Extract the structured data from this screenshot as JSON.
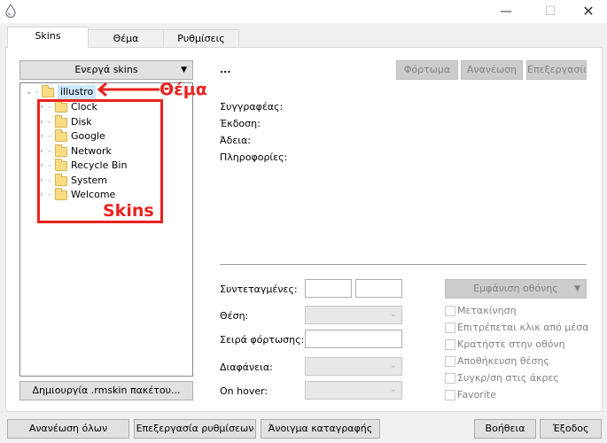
{
  "window": {
    "minimize_glyph": "—",
    "maximize_glyph": "☐",
    "close_glyph": "✕",
    "app_icon": "rainmeter-drop-icon"
  },
  "tabs": [
    {
      "label": "Skins",
      "active": true
    },
    {
      "label": "Θέμα",
      "active": false
    },
    {
      "label": "Ρυθμίσεις",
      "active": false
    }
  ],
  "skins_panel": {
    "active_skins_button": "Ενεργά skins",
    "tree": {
      "root": "illustro",
      "children": [
        "Clock",
        "Disk",
        "Google",
        "Network",
        "Recycle Bin",
        "System",
        "Welcome"
      ]
    },
    "create_package_button": "Δημιουργία .rmskin πακέτου..."
  },
  "details": {
    "skin_name": "...",
    "load_button": "Φόρτωμα",
    "refresh_button": "Ανανέωση",
    "edit_button": "Επεξεργασία",
    "author_label": "Συγγραφέας:",
    "version_label": "Έκδοση:",
    "license_label": "Άδεια:",
    "info_label": "Πληροφορίες:"
  },
  "settings": {
    "coordinates_label": "Συντεταγμένες:",
    "position_label": "Θέση:",
    "load_order_label": "Σειρά φόρτωσης:",
    "transparency_label": "Διαφάνεια:",
    "on_hover_label": "On hover:",
    "display_monitor_button": "Εμφάνιση οθόνης",
    "checkboxes": [
      "Μετακίνηση",
      "Επιτρέπεται κλικ από μέσα",
      "Κρατήστε στην οθόνη",
      "Αποθήκευση θέσης",
      "Συγκρ/ση στις άκρες",
      "Favorite"
    ]
  },
  "footer": {
    "refresh_all": "Ανανέωση όλων",
    "edit_settings": "Επεξεργασία ρυθμίσεων",
    "open_log": "Άνοιγμα καταγραφής",
    "help": "Βοήθεια",
    "exit": "Έξοδος"
  },
  "annotations": {
    "theme_label": "Θέμα",
    "skins_label": "Skins",
    "color": "#e8231f"
  }
}
